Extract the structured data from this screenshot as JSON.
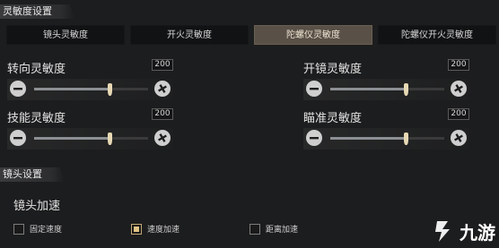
{
  "sections": {
    "sensitivity_title": "灵敏度设置",
    "lens_title": "镜头设置"
  },
  "tabs": [
    {
      "label": "镜头灵敏度",
      "active": false
    },
    {
      "label": "开火灵敏度",
      "active": false
    },
    {
      "label": "陀螺仪灵敏度",
      "active": true
    },
    {
      "label": "陀螺仪开火灵敏度",
      "active": false
    }
  ],
  "sliders": [
    {
      "label": "转向灵敏度",
      "value": "200",
      "level": 0.66
    },
    {
      "label": "开镜灵敏度",
      "value": "200",
      "level": 0.66
    },
    {
      "label": "技能灵敏度",
      "value": "200",
      "level": 0.66
    },
    {
      "label": "瞄准灵敏度",
      "value": "200",
      "level": 0.66
    }
  ],
  "lens": {
    "label": "镜头加速",
    "options": [
      {
        "label": "固定速度",
        "checked": false
      },
      {
        "label": "速度加速",
        "checked": true
      },
      {
        "label": "距离加速",
        "checked": false
      }
    ]
  },
  "watermark": {
    "text": "九游",
    "icon": "jiuyou-logo-icon"
  },
  "icons": {
    "minus": "minus-circle-icon",
    "plus": "plus-circle-icon"
  },
  "colors": {
    "accent": "#e1c584",
    "tab_active": "#595047"
  }
}
